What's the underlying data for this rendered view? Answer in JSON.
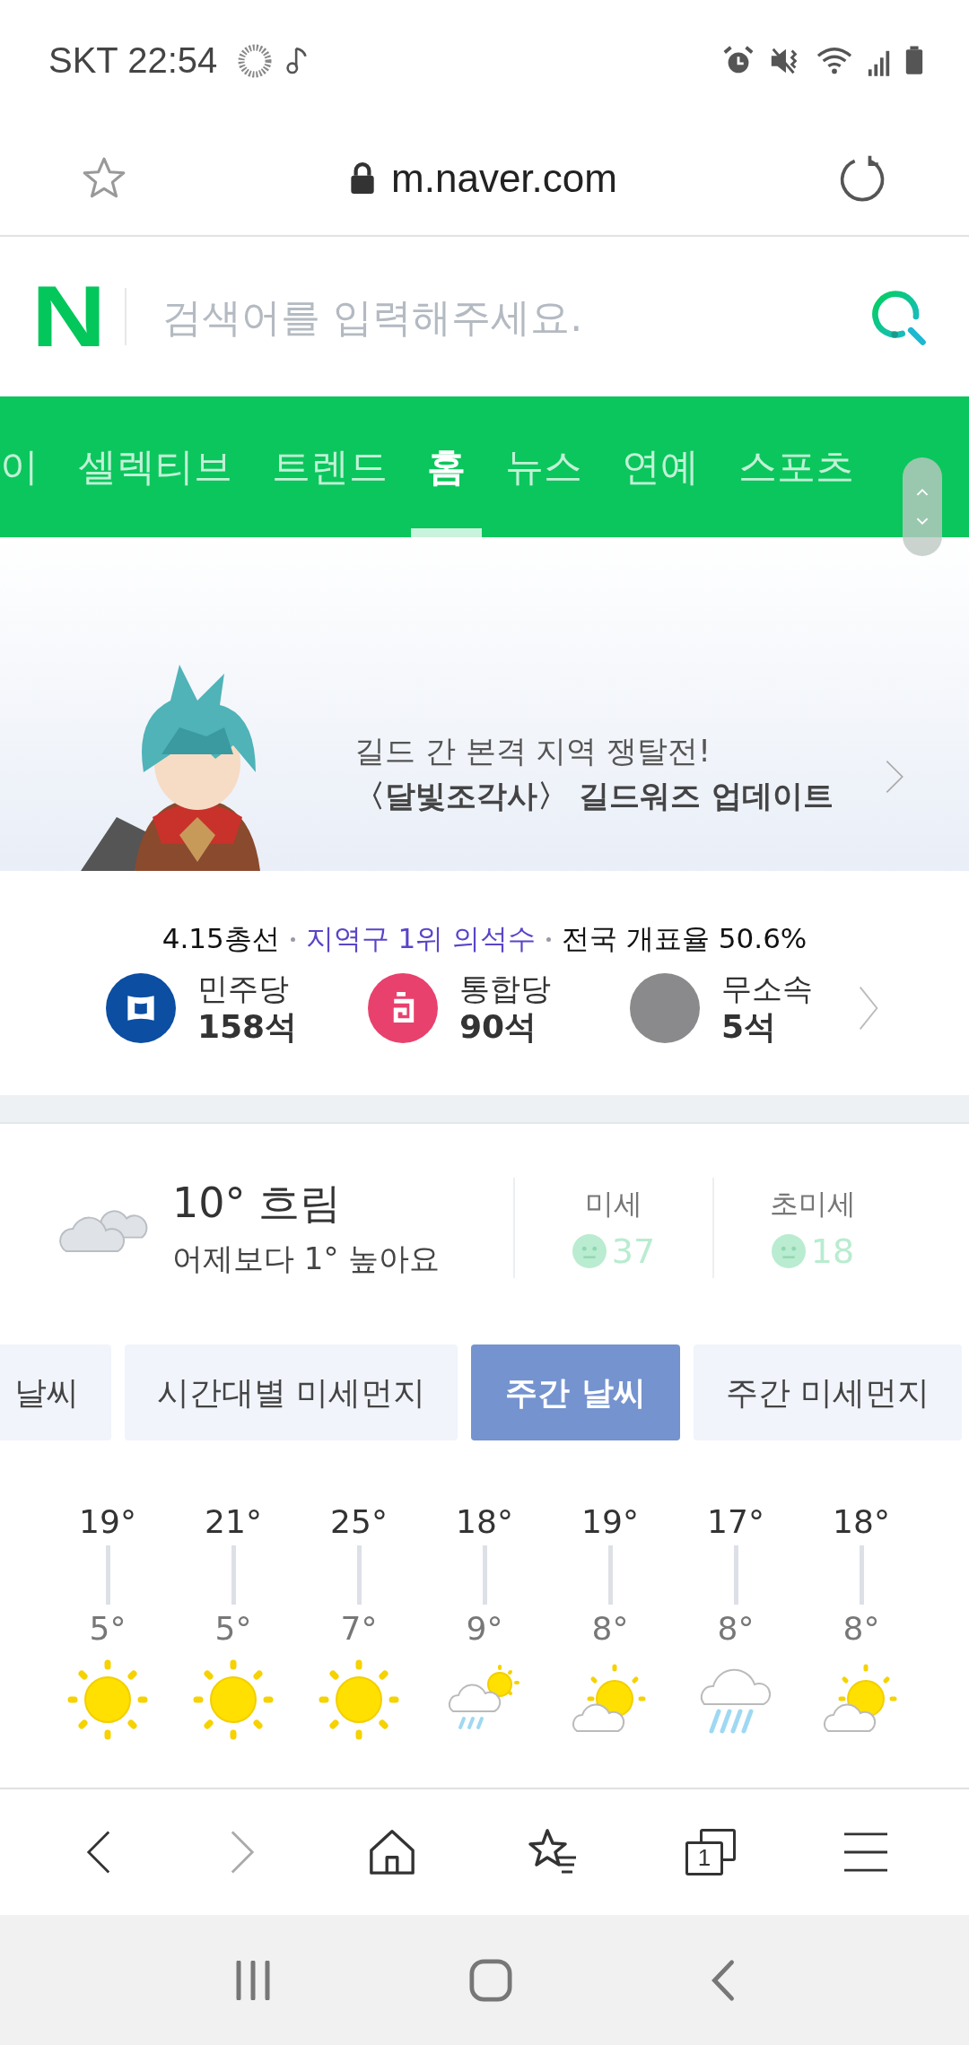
{
  "status_bar": {
    "carrier_time": "SKT 22:54"
  },
  "browser": {
    "url": "m.naver.com"
  },
  "search": {
    "logo": "N",
    "placeholder": "검색어를 입력해주세요."
  },
  "nav_tabs": [
    {
      "label": "이",
      "selected": false
    },
    {
      "label": "셀렉티브",
      "selected": false
    },
    {
      "label": "트렌드",
      "selected": false
    },
    {
      "label": "홈",
      "selected": true
    },
    {
      "label": "뉴스",
      "selected": false
    },
    {
      "label": "연예",
      "selected": false
    },
    {
      "label": "스포츠",
      "selected": false
    }
  ],
  "banner": {
    "line_1": "길드 간 본격 지역 쟁탈전!",
    "line_2": "〈달빛조각사〉 길드워즈 업데이트"
  },
  "election": {
    "title": "4.15총선",
    "subtitle": "지역구 1위 의석수",
    "turnout": "전국 개표율 50.6%",
    "parties": [
      {
        "name": "민주당",
        "seats": "158석",
        "color": "#0b4ea2",
        "kind": "flag"
      },
      {
        "name": "통합당",
        "seats": "90석",
        "color": "#e8416d",
        "kind": "knot"
      },
      {
        "name": "무소속",
        "seats": "5석",
        "color": "#8a8a8c",
        "kind": "plain"
      }
    ]
  },
  "weather": {
    "temperature": "10°",
    "condition": "흐림",
    "compare": "어제보다 1° 높아요",
    "dust": [
      {
        "label": "미세",
        "value": "37",
        "color": "#b9ecd0"
      },
      {
        "label": "초미세",
        "value": "18",
        "color": "#b9ecd0"
      }
    ],
    "tabs": [
      {
        "label": "날씨",
        "selected": false
      },
      {
        "label": "시간대별 미세먼지",
        "selected": false
      },
      {
        "label": "주간 날씨",
        "selected": true
      },
      {
        "label": "주간 미세먼지",
        "selected": false
      }
    ],
    "forecast": [
      {
        "high": "19°",
        "low": "5°",
        "kind": "sunny"
      },
      {
        "high": "21°",
        "low": "5°",
        "kind": "sunny"
      },
      {
        "high": "25°",
        "low": "7°",
        "kind": "sunny"
      },
      {
        "high": "18°",
        "low": "9°",
        "kind": "sun_rain"
      },
      {
        "high": "19°",
        "low": "8°",
        "kind": "partly_cloudy"
      },
      {
        "high": "17°",
        "low": "8°",
        "kind": "rain"
      },
      {
        "high": "18°",
        "low": "8°",
        "kind": "partly_cloudy"
      }
    ]
  },
  "bottom_bar": {
    "forward_disabled": true,
    "tab_count": "1"
  }
}
